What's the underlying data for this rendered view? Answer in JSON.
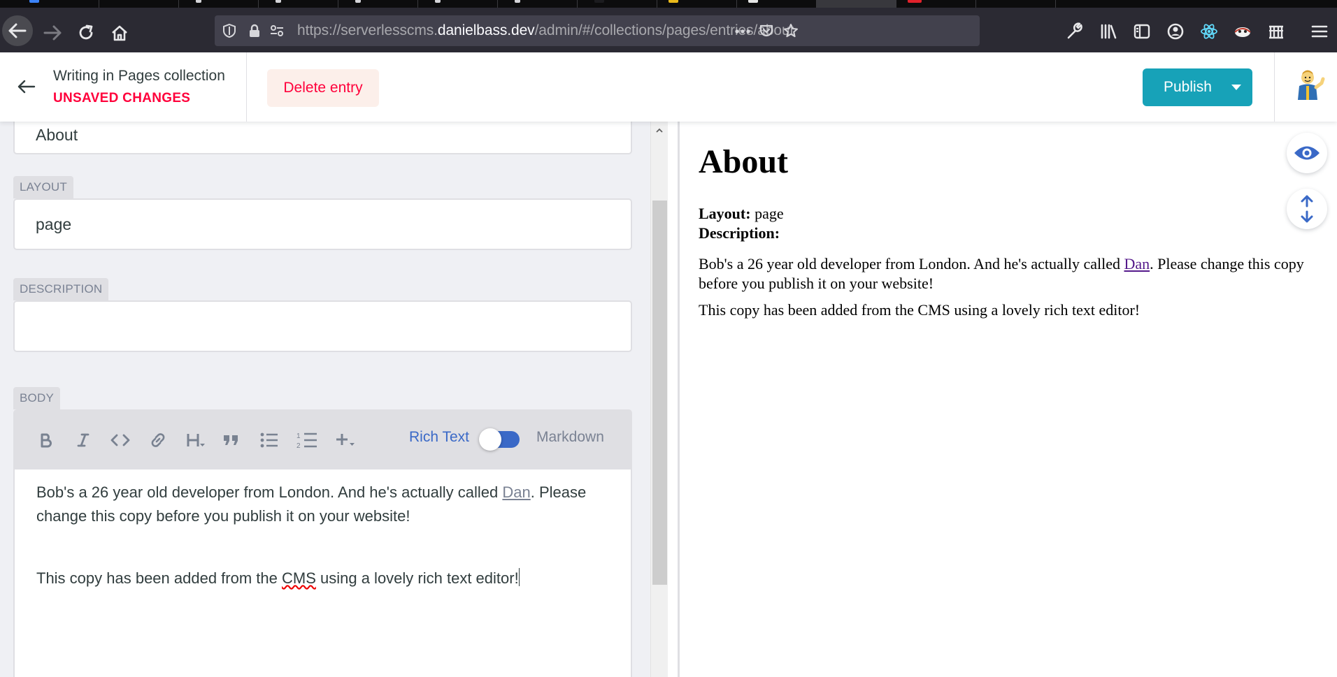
{
  "browser": {
    "url_prefix": "https://serverlesscms.",
    "url_domain": "danielbass.dev",
    "url_path": "/admin/#/collections/pages/entries/about",
    "page_actions_icon": "ellipsis-icon",
    "colors": {
      "chrome": "#2b2a33",
      "urlbar": "#42414d"
    }
  },
  "header": {
    "writing_in": "Writing in Pages collection",
    "status": "UNSAVED CHANGES",
    "delete_label": "Delete entry",
    "publish_label": "Publish",
    "colors": {
      "publish": "#17a2b8",
      "danger": "#ff003b"
    }
  },
  "editor": {
    "title_value": "About",
    "fields": {
      "layout": {
        "label": "LAYOUT",
        "value": "page"
      },
      "description": {
        "label": "DESCRIPTION",
        "value": ""
      },
      "body": {
        "label": "BODY"
      }
    },
    "toolbar": {
      "tools": [
        "bold-icon",
        "italic-icon",
        "code-icon",
        "link-icon",
        "heading-icon",
        "quote-icon",
        "bulleted-list-icon",
        "numbered-list-icon",
        "add-component-icon"
      ],
      "rich_text_label": "Rich Text",
      "markdown_label": "Markdown",
      "mode": "Rich Text"
    },
    "body": {
      "p1_before": "Bob's a 26 year old developer from London. And he's actually called ",
      "p1_link": "Dan",
      "p1_after": ". Please change this copy before you publish it on your website!",
      "p2_before": "This copy has been added from the ",
      "p2_spell": "CMS",
      "p2_after": " using a lovely rich text editor!"
    }
  },
  "preview": {
    "title": "About",
    "layout_key": "Layout:",
    "layout_value": "page",
    "description_key": "Description:",
    "p1_before": "Bob's a 26 year old developer from London. And he's actually called ",
    "p1_link": "Dan",
    "p1_after": ". Please change this copy before you publish it on your website!",
    "p2": "This copy has been added from the CMS using a lovely rich text editor!"
  }
}
